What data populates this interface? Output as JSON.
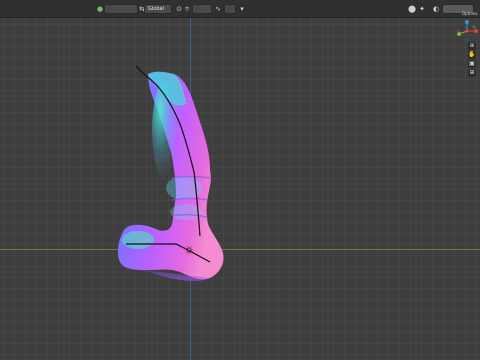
{
  "header": {
    "orientation": {
      "icon": "axes-orientation-icon",
      "value": "Global"
    },
    "tool_label": "Options",
    "icons": [
      "mode-icon",
      "select-box-icon",
      "transform-pivot-icon",
      "snap-icon",
      "proportional-edit-icon",
      "filter-icon",
      "overlay-icon",
      "shading-solid-icon"
    ]
  },
  "gizmo": {
    "axes": [
      "X",
      "Y",
      "Z"
    ],
    "colors": {
      "x": "#e0424f",
      "y": "#7bb731",
      "z": "#3b8cdc"
    },
    "nav_buttons": [
      "zoom-icon",
      "hand-pan-icon",
      "camera-icon",
      "perspective-grid-icon"
    ]
  },
  "viewport": {
    "background": "#3e3e3e",
    "axis_x_color": "#6f7d33",
    "axis_y_color": "#3e5f8c",
    "object_shading": "normal-map"
  }
}
